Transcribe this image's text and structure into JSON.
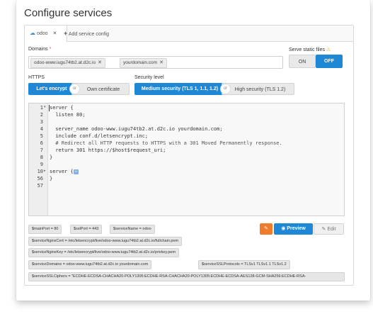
{
  "title": "Configure services",
  "tabs": {
    "active_label": "odoo",
    "add_label": "Add service config"
  },
  "domains": {
    "label": "Domains",
    "required_mark": "*",
    "tags": [
      "odoo-www.iugu74tb2.at.d2c.io",
      "yourdomain.com"
    ]
  },
  "static": {
    "label": "Serve static files",
    "on": "ON",
    "off": "OFF"
  },
  "https": {
    "label": "HTTPS",
    "letsencrypt": "Let's encrypt",
    "or": "or",
    "own": "Own certificate"
  },
  "security": {
    "label": "Security level",
    "medium": "Medium security (TLS 1, 1.1, 1.2)",
    "or": "or",
    "high": "High security (TLS 1.2)"
  },
  "editor": {
    "line_numbers": [
      "1",
      "2",
      "3",
      "4",
      "5",
      "6",
      "7",
      "8",
      "9",
      "10",
      "56",
      "57"
    ],
    "lines": [
      "server {",
      "  listen 80;",
      "",
      "  server_name odoo-www.iugu74tb2.at.d2c.io yourdomain.com;",
      "  include conf.d/letsencrypt.inc;",
      "  # Redirect all HTTP requests to HTTPS with a 301 Moved Permanently response.",
      "  return 301 https://$host$request_uri;",
      "}",
      "",
      "server {",
      "}",
      ""
    ],
    "fold_marker": "↔"
  },
  "variables": [
    "$mainPort = 80",
    "$sslPort = 443",
    "$serviceName = odoo",
    "$serviceNginxCert = /etc/letsencrypt/live/odoo-www.iugu74tb2.at.d2c.io/fullchain.pem",
    "$serviceNginxKey = /etc/letsencrypt/live/odoo-www.iugu74tb2.at.d2c.io/privkey.pem",
    "$serviceDomains = odoo-www.iugu74tb2.at.d2c.io yourdomain.com",
    "$serviceSSLProtocols = TLSv1 TLSv1.1 TLSv1.2",
    "$serviceSSLCiphers = \"ECDHE-ECDSA-CHACHA20-POLY1305:ECDHE-RSA-CHACHA20-POLY1305:ECDHE-ECDSA-AES128-GCM-SHA256:ECDHE-RSA-"
  ],
  "actions": {
    "preview": "Preview",
    "edit": "Edit"
  },
  "colors": {
    "accent": "#1e88d7",
    "erase": "#f07b2a",
    "warning": "#e6a800"
  }
}
